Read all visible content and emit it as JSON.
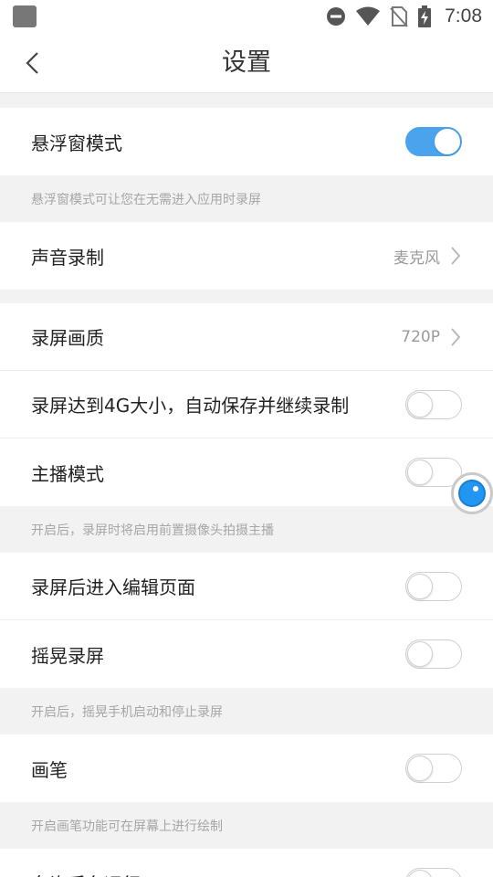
{
  "status_bar": {
    "time": "7:08",
    "icons": [
      "dnd-icon",
      "wifi-icon",
      "no-sim-icon",
      "battery-charging-icon"
    ]
  },
  "header": {
    "title": "设置",
    "back_icon": "chevron-left-icon"
  },
  "settings": {
    "floating_window": {
      "label": "悬浮窗模式",
      "enabled": true
    },
    "floating_window_hint": "悬浮窗模式可让您在无需进入应用时录屏",
    "audio_record": {
      "label": "声音录制",
      "value": "麦克风"
    },
    "quality": {
      "label": "录屏画质",
      "value": "720P"
    },
    "auto_save_4g": {
      "label": "录屏达到4G大小，自动保存并继续录制",
      "enabled": false
    },
    "anchor_mode": {
      "label": "主播模式",
      "enabled": false
    },
    "anchor_mode_hint": "开启后，录屏时将启用前置摄像头拍摄主播",
    "edit_after": {
      "label": "录屏后进入编辑页面",
      "enabled": false
    },
    "shake_record": {
      "label": "摇晃录屏",
      "enabled": false
    },
    "shake_record_hint": "开启后，摇晃手机启动和停止录屏",
    "brush": {
      "label": "画笔",
      "enabled": false
    },
    "brush_hint": "开启画笔功能可在屏幕上进行绘制",
    "background_run": {
      "label": "允许后台运行",
      "enabled": false
    }
  },
  "colors": {
    "accent": "#4aa3ec",
    "background": "#f2f2f2",
    "hint_text": "#a6a6a6"
  }
}
